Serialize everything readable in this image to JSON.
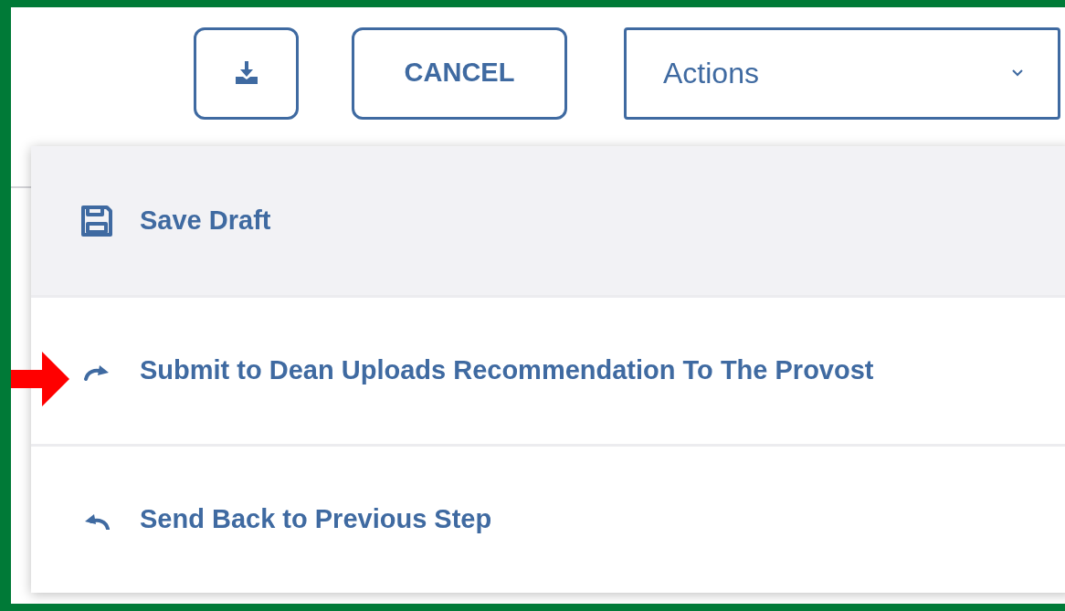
{
  "toolbar": {
    "cancel_button": "CANCEL",
    "actions_dropdown": "Actions"
  },
  "menu": {
    "items": [
      {
        "label": "Save Draft",
        "kind": "save",
        "selected": true
      },
      {
        "label": "Submit to Dean Uploads Recommendation To The Provost",
        "kind": "submit",
        "selected": false
      },
      {
        "label": "Send Back to Previous Step",
        "kind": "return",
        "selected": false
      }
    ]
  }
}
